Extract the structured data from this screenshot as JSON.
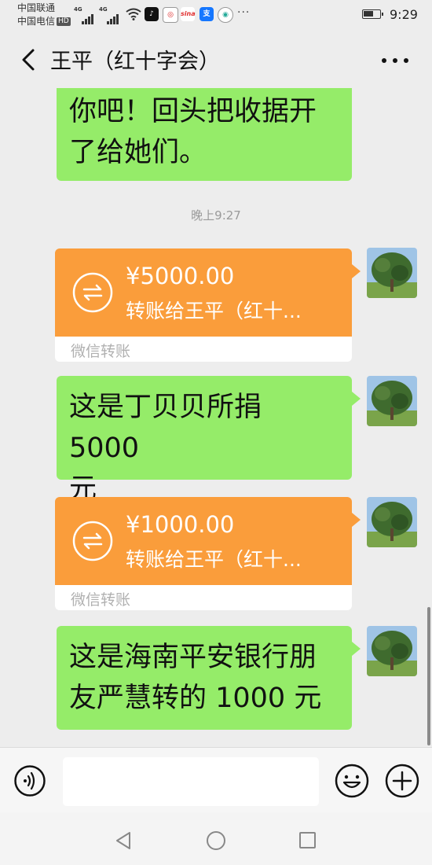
{
  "status_bar": {
    "carrier_1": "中国联通",
    "carrier_2": "中国电信",
    "hd_badge": "HD",
    "network_1": "4G",
    "network_2": "4G",
    "app_icons": [
      "tiktok-icon",
      "weibo-icon",
      "sina-icon",
      "alipay-icon",
      "browser-icon"
    ],
    "more_notifications": "···",
    "time": "9:29"
  },
  "header": {
    "title": "王平（红十字会）"
  },
  "messages": [
    {
      "type": "text",
      "side": "right",
      "lines": [
        "你吧！回头把收据开",
        "了给她们。"
      ]
    },
    {
      "type": "time",
      "text": "晚上9:27"
    },
    {
      "type": "transfer",
      "side": "right",
      "amount": "¥5000.00",
      "description": "转账给王平（红十...",
      "label": "微信转账"
    },
    {
      "type": "text",
      "side": "right",
      "lines": [
        "这是丁贝贝所捐 5000",
        "元"
      ]
    },
    {
      "type": "transfer",
      "side": "right",
      "amount": "¥1000.00",
      "description": "转账给王平（红十...",
      "label": "微信转账"
    },
    {
      "type": "text",
      "side": "right",
      "lines": [
        "这是海南平安银行朋",
        "友严慧转的 1000 元"
      ]
    }
  ],
  "input_bar": {
    "placeholder": ""
  },
  "colors": {
    "chat_background": "#ededed",
    "sent_bubble": "#95ec69",
    "transfer_orange": "#fa9d3b",
    "time_text": "#9a9a9a"
  }
}
